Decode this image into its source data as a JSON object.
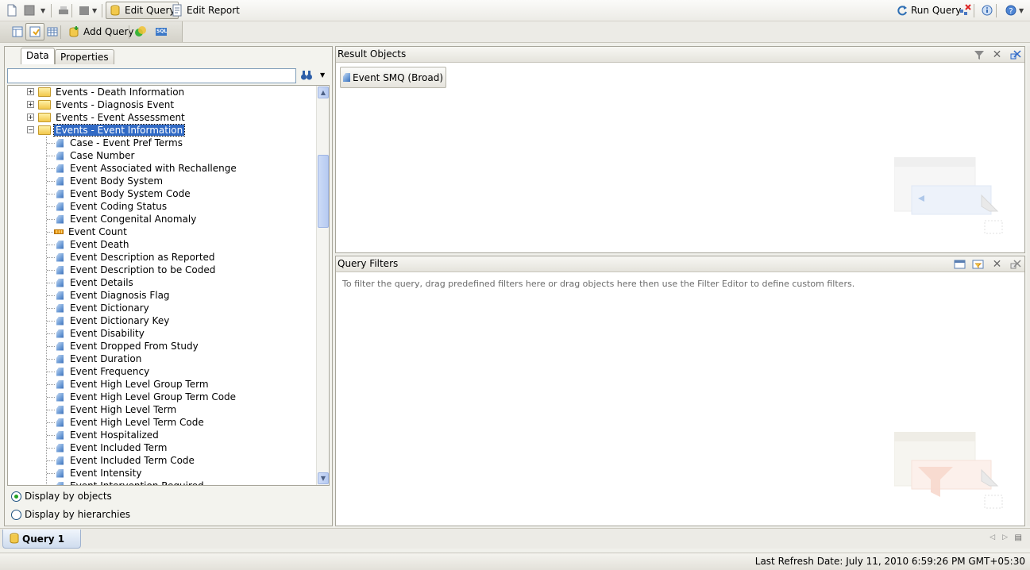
{
  "toolbar": {
    "edit_query": "Edit Query",
    "edit_report": "Edit Report",
    "run_query": "Run Query",
    "add_query": "Add Query",
    "sql_label": "SQL"
  },
  "left_panel": {
    "tabs": [
      "Data",
      "Properties"
    ],
    "search_value": "",
    "tree": {
      "folders": [
        {
          "label": "Events - Death Information",
          "expanded": false
        },
        {
          "label": "Events - Diagnosis Event",
          "expanded": false
        },
        {
          "label": "Events - Event Assessment",
          "expanded": false
        },
        {
          "label": "Events - Event Information",
          "expanded": true,
          "selected": true
        }
      ],
      "children": [
        {
          "label": "Case - Event Pref Terms",
          "kind": "dimension"
        },
        {
          "label": "Case Number",
          "kind": "dimension"
        },
        {
          "label": "Event Associated with Rechallenge",
          "kind": "dimension"
        },
        {
          "label": "Event Body System",
          "kind": "dimension"
        },
        {
          "label": "Event Body System Code",
          "kind": "dimension"
        },
        {
          "label": "Event Coding Status",
          "kind": "dimension"
        },
        {
          "label": "Event Congenital Anomaly",
          "kind": "dimension"
        },
        {
          "label": "Event Count",
          "kind": "measure"
        },
        {
          "label": "Event Death",
          "kind": "dimension"
        },
        {
          "label": "Event Description as Reported",
          "kind": "dimension"
        },
        {
          "label": "Event Description to be Coded",
          "kind": "dimension"
        },
        {
          "label": "Event Details",
          "kind": "dimension"
        },
        {
          "label": "Event Diagnosis Flag",
          "kind": "dimension"
        },
        {
          "label": "Event Dictionary",
          "kind": "dimension"
        },
        {
          "label": "Event Dictionary Key",
          "kind": "dimension"
        },
        {
          "label": "Event Disability",
          "kind": "dimension"
        },
        {
          "label": "Event Dropped From Study",
          "kind": "dimension"
        },
        {
          "label": "Event Duration",
          "kind": "dimension"
        },
        {
          "label": "Event Frequency",
          "kind": "dimension"
        },
        {
          "label": "Event High Level Group Term",
          "kind": "dimension"
        },
        {
          "label": "Event High Level Group Term Code",
          "kind": "dimension"
        },
        {
          "label": "Event High Level Term",
          "kind": "dimension"
        },
        {
          "label": "Event High Level Term Code",
          "kind": "dimension"
        },
        {
          "label": "Event Hospitalized",
          "kind": "dimension"
        },
        {
          "label": "Event Included Term",
          "kind": "dimension"
        },
        {
          "label": "Event Included Term Code",
          "kind": "dimension"
        },
        {
          "label": "Event Intensity",
          "kind": "dimension"
        },
        {
          "label": "Event Intervention Required",
          "kind": "dimension"
        }
      ]
    },
    "display_options": [
      {
        "label": "Display by objects",
        "selected": true
      },
      {
        "label": "Display by hierarchies",
        "selected": false
      }
    ]
  },
  "result_objects": {
    "title": "Result Objects",
    "items": [
      "Event SMQ (Broad)"
    ]
  },
  "query_filters": {
    "title": "Query Filters",
    "hint": "To filter the query, drag predefined filters here or drag objects here then use the Filter Editor to define custom filters."
  },
  "bottom": {
    "query_tab": "Query 1",
    "status": "Last Refresh Date: July 11, 2010 6:59:26 PM GMT+05:30"
  },
  "colors": {
    "selection": "#316ac5",
    "panel_border": "#a8a69b",
    "folder": "#f2c84b"
  }
}
